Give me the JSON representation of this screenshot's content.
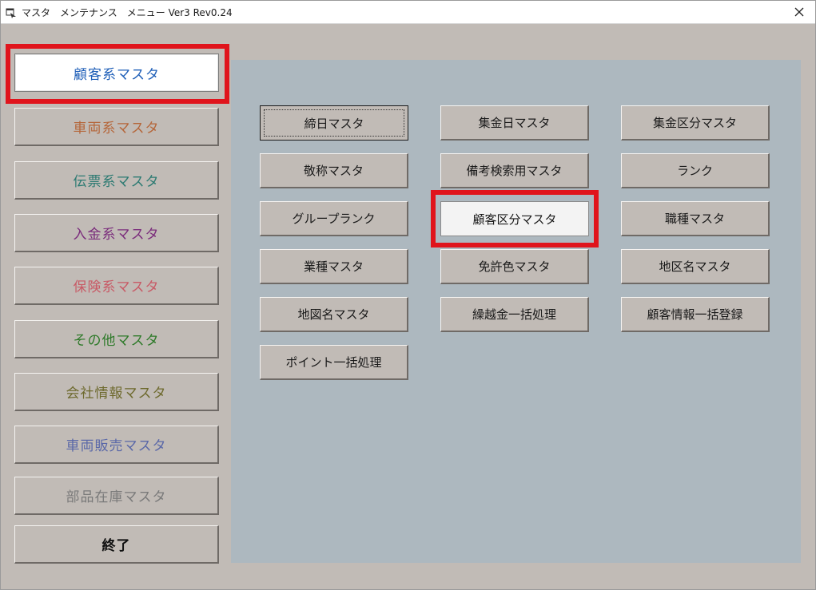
{
  "window": {
    "title": "マスタ　メンテナンス　メニュー Ver3 Rev0.24",
    "icons": {
      "app": "app-window-icon",
      "close": "close-icon"
    }
  },
  "sidebar": {
    "items": [
      {
        "label": "顧客系マスタ",
        "color": "#1f5fb8",
        "active": true
      },
      {
        "label": "車両系マスタ",
        "color": "#b5663a"
      },
      {
        "label": "伝票系マスタ",
        "color": "#2c7a72"
      },
      {
        "label": "入金系マスタ",
        "color": "#7b2d7c"
      },
      {
        "label": "保険系マスタ",
        "color": "#c85a66"
      },
      {
        "label": "その他マスタ",
        "color": "#2f7a2a"
      },
      {
        "label": "会社情報マスタ",
        "color": "#6e6a2e"
      },
      {
        "label": "車両販売マスタ",
        "color": "#5a68a8"
      },
      {
        "label": "部品在庫マスタ",
        "color": "#7a7a7a"
      },
      {
        "label": "終了",
        "color": "#111111"
      }
    ]
  },
  "grid": {
    "buttons": [
      "締日マスタ",
      "集金日マスタ",
      "集金区分マスタ",
      "敬称マスタ",
      "備考検索用マスタ",
      "ランク",
      "グループランク",
      "顧客区分マスタ",
      "職種マスタ",
      "業種マスタ",
      "免許色マスタ",
      "地区名マスタ",
      "地図名マスタ",
      "繰越金一括処理",
      "顧客情報一括登録",
      "ポイント一括処理"
    ]
  },
  "colors": {
    "highlight": "#e0141c",
    "panel": "#adb8bf",
    "face": "#c1bbb6"
  }
}
